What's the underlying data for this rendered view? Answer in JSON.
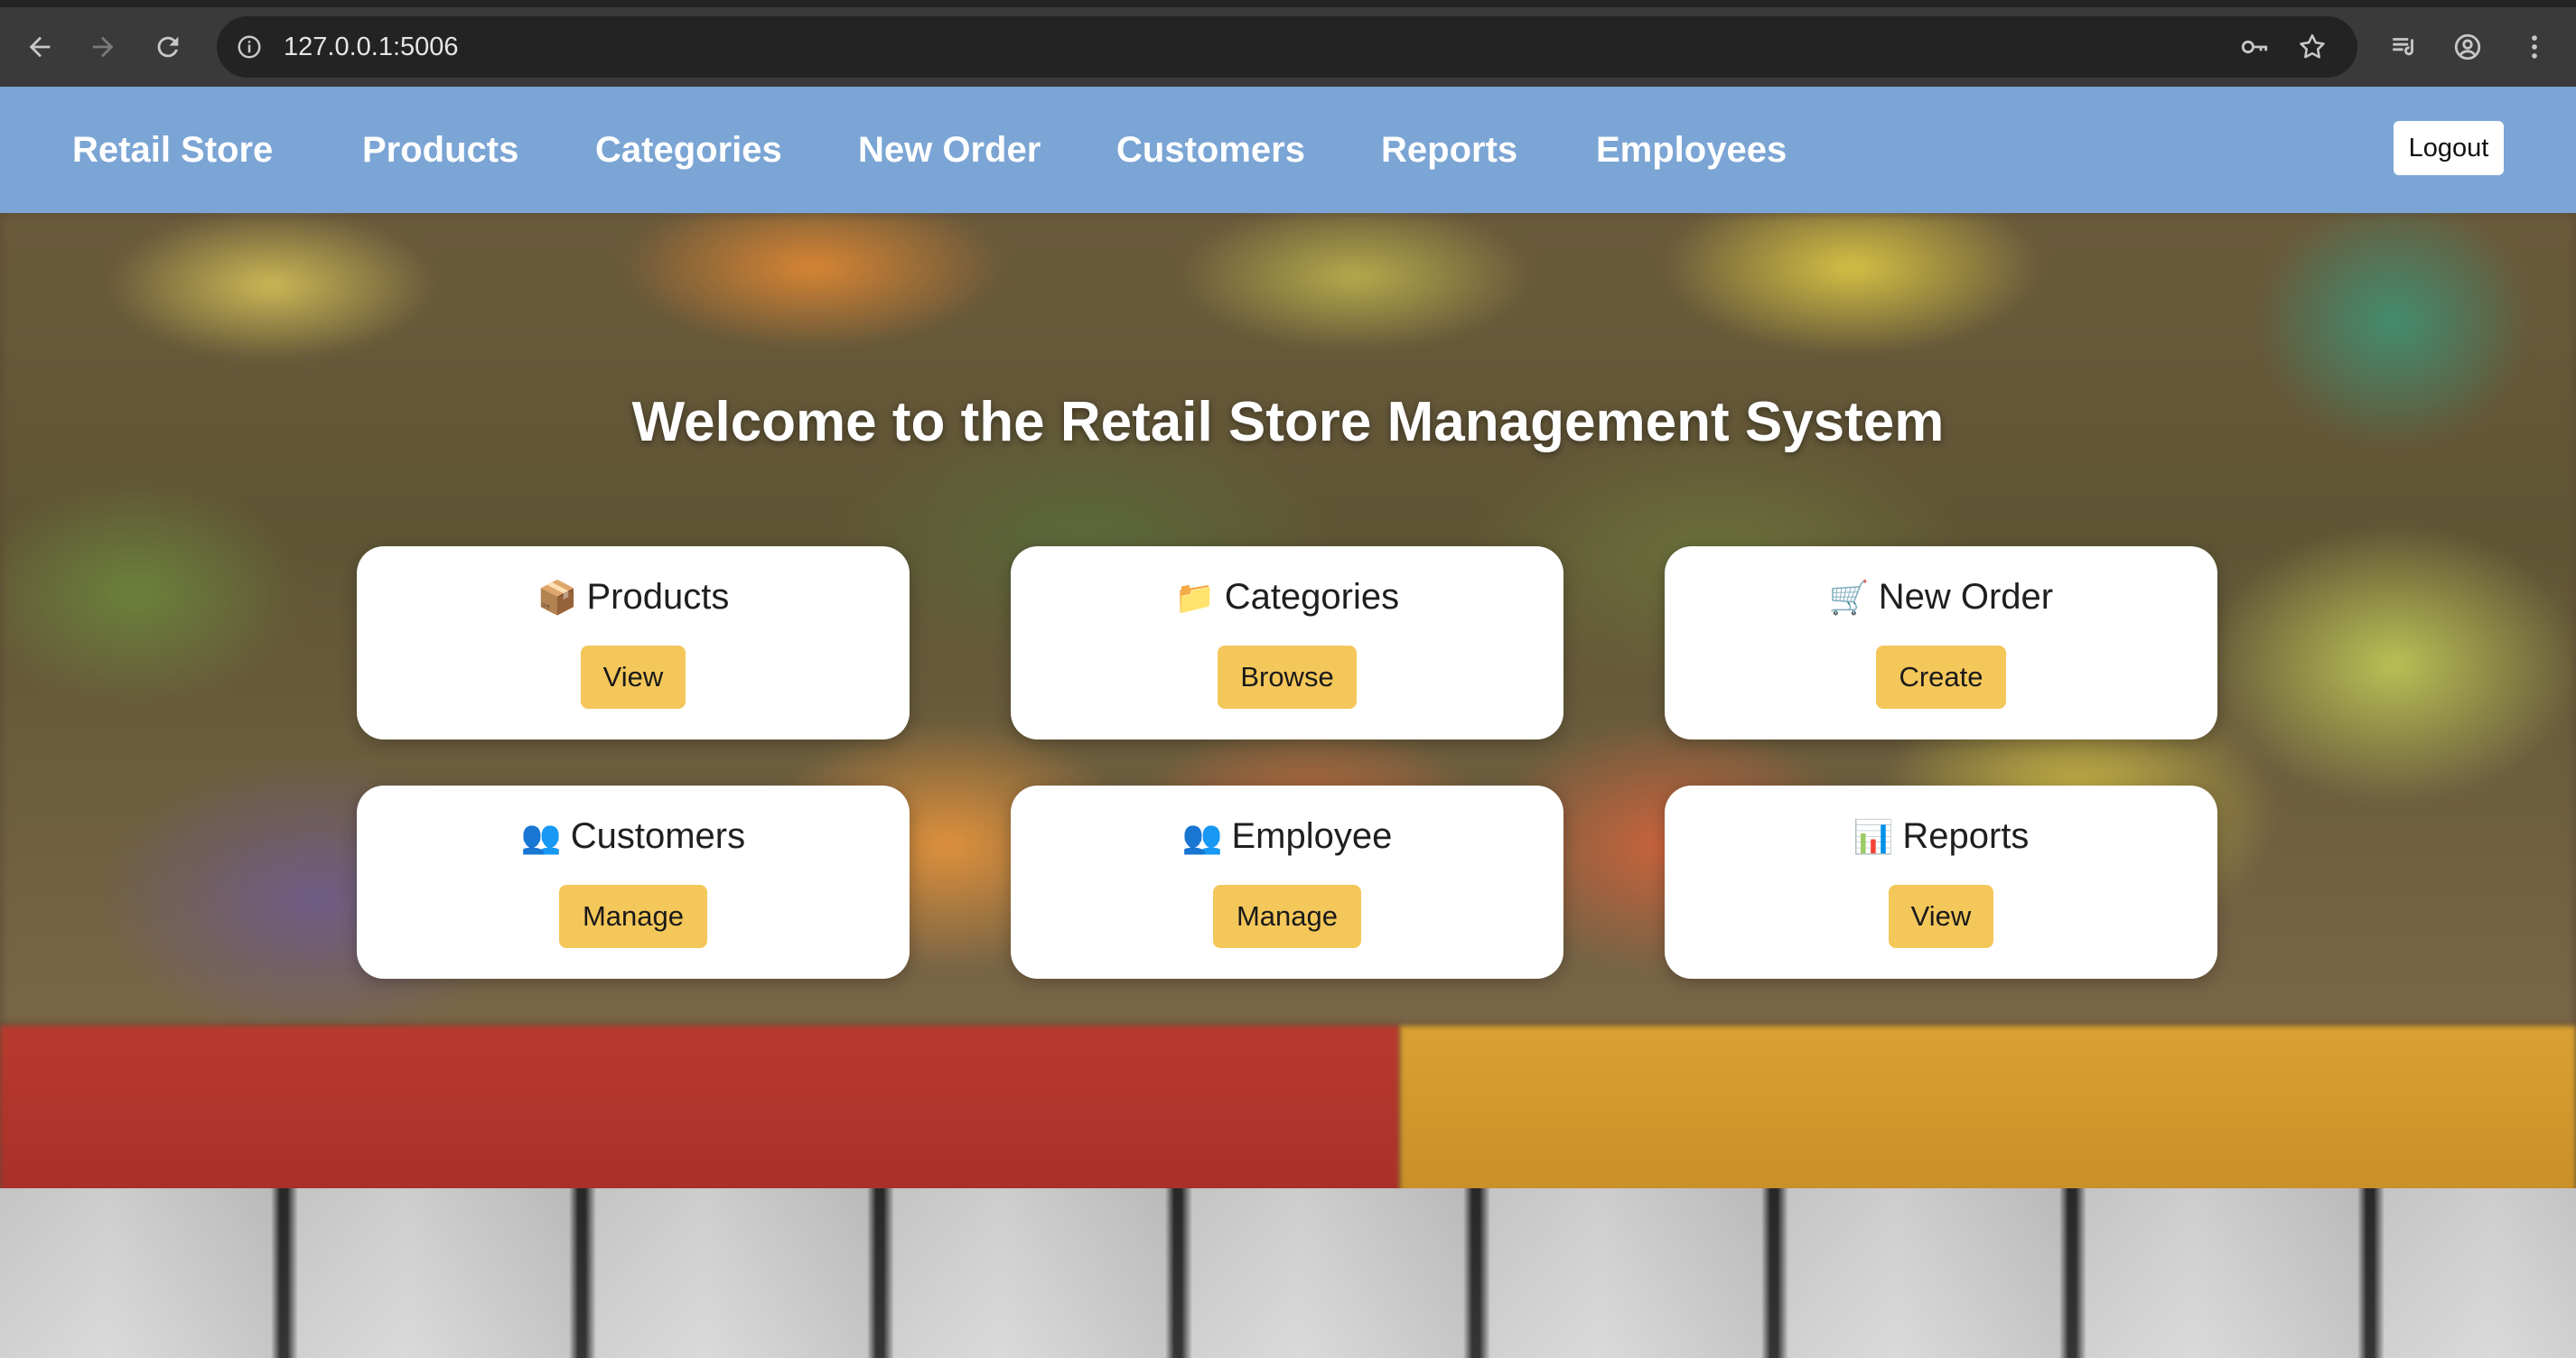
{
  "browser": {
    "url": "127.0.0.1:5006"
  },
  "navbar": {
    "brand": "Retail Store",
    "links": [
      "Products",
      "Categories",
      "New Order",
      "Customers",
      "Reports",
      "Employees"
    ],
    "logout_label": "Logout",
    "background_color": "#7ba5d4"
  },
  "main": {
    "title": "Welcome to the Retail Store Management System",
    "cards": [
      {
        "emoji": "📦",
        "icon_name": "package-icon",
        "title": "Products",
        "button": "View"
      },
      {
        "emoji": "📁",
        "icon_name": "folder-icon",
        "title": "Categories",
        "button": "Browse"
      },
      {
        "emoji": "🛒",
        "icon_name": "cart-icon",
        "title": "New Order",
        "button": "Create"
      },
      {
        "emoji": "👥",
        "icon_name": "people-icon",
        "title": "Customers",
        "button": "Manage"
      },
      {
        "emoji": "👥",
        "icon_name": "people-icon",
        "title": "Employee",
        "button": "Manage"
      },
      {
        "emoji": "📊",
        "icon_name": "bar-chart-icon",
        "title": "Reports",
        "button": "View"
      }
    ],
    "button_color": "#f4c75a"
  }
}
